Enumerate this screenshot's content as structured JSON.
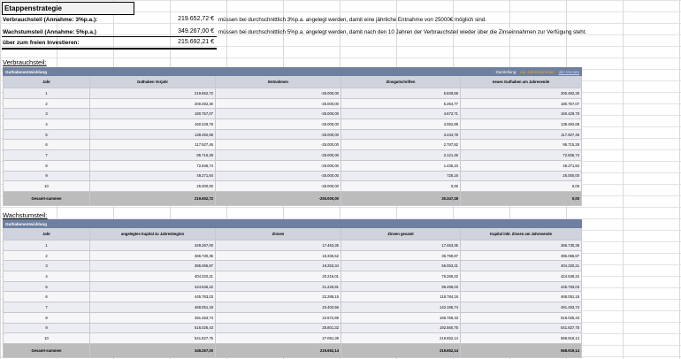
{
  "header": {
    "title": "Etappenstrategie",
    "rows": [
      {
        "label": "Verbrauchsteil (Annahme: 3%p.a.):",
        "value": "219.652,72 €",
        "note": "müssen bei durchschnittlich 3%p.a. angelegt werden, damit eine jährliche Entnahme von 25000€ möglich sind."
      },
      {
        "label": "Wachstumsteil (Annahme: 5%p.a.)",
        "value": "349.267,00 €",
        "note": "müssen bei durchschnittlich 5%p.a. angelegt werden, damit nach den 10 Jahren der Verbrauchsteil wieder über die Zinseinnahmen zur Verfügung steht."
      },
      {
        "label": "über zum freien Investieren:",
        "value": "215.692,21 €",
        "note": ""
      }
    ]
  },
  "verbrauch": {
    "section_label": "Verbrauchsteil:",
    "table_title": "Guthabenentwicklung",
    "darstellung": "Darstellung:",
    "opt1": "nur Jahressummen",
    "opt2": "alle Monate",
    "columns": [
      "Jahr",
      "Guthaben Vorjahr",
      "Entnahmen",
      "Zinsgutschriften",
      "neues Guthaben am Jahresende"
    ],
    "rows": [
      [
        "1",
        "219.652,72",
        "-25.000,00",
        "5.839,58",
        "200.492,30"
      ],
      [
        "2",
        "200.492,30",
        "-25.000,00",
        "5.264,77",
        "180.757,07"
      ],
      [
        "3",
        "180.757,07",
        "-25.000,00",
        "4.672,71",
        "160.429,78"
      ],
      [
        "4",
        "160.429,78",
        "-25.000,00",
        "4.062,89",
        "139.492,68"
      ],
      [
        "5",
        "139.492,68",
        "-25.000,00",
        "3.434,78",
        "117.927,46"
      ],
      [
        "6",
        "117.927,46",
        "-25.000,00",
        "2.787,82",
        "95.715,28"
      ],
      [
        "7",
        "95.715,28",
        "-25.000,00",
        "2.121,46",
        "72.836,74"
      ],
      [
        "8",
        "72.836,74",
        "-25.000,00",
        "1.435,10",
        "49.271,84"
      ],
      [
        "9",
        "49.271,84",
        "-25.000,00",
        "728,16",
        "25.000,00"
      ],
      [
        "10",
        "25.000,00",
        "-25.000,00",
        "0,00",
        "0,00"
      ]
    ],
    "totals": [
      "Gesamt-summen",
      "219.652,72",
      "-250.000,00",
      "30.347,28",
      "0,00"
    ]
  },
  "wachstum": {
    "section_label": "Wachstumsteil:",
    "table_title": "Guthabenentwicklung",
    "columns": [
      "Jahr",
      "angelegtes Kapital zu Jahresbeginn",
      "Zinsen",
      "Zinsen gesamt",
      "Kapital inkl. Zinsen am Jahresende"
    ],
    "rows": [
      [
        "1",
        "349.267,00",
        "17.463,35",
        "17.463,35",
        "366.730,35"
      ],
      [
        "2",
        "366.730,35",
        "18.336,52",
        "35.799,87",
        "385.066,87"
      ],
      [
        "3",
        "385.066,87",
        "19.253,34",
        "55.053,21",
        "404.320,21"
      ],
      [
        "4",
        "404.320,21",
        "20.216,01",
        "75.269,22",
        "424.536,22"
      ],
      [
        "5",
        "424.536,22",
        "21.226,81",
        "96.496,03",
        "445.763,03"
      ],
      [
        "6",
        "445.763,03",
        "22.288,15",
        "118.784,18",
        "468.051,18"
      ],
      [
        "7",
        "468.051,18",
        "23.402,56",
        "142.186,74",
        "491.453,74"
      ],
      [
        "8",
        "491.453,74",
        "24.572,69",
        "166.759,43",
        "516.026,43"
      ],
      [
        "9",
        "516.026,43",
        "25.801,32",
        "192.560,75",
        "541.827,75"
      ],
      [
        "10",
        "541.827,75",
        "27.091,39",
        "219.652,14",
        "568.919,14"
      ]
    ],
    "totals": [
      "Gesamt-summen",
      "349.267,00",
      "219.652,14",
      "219.652,14",
      "568.919,14"
    ]
  }
}
